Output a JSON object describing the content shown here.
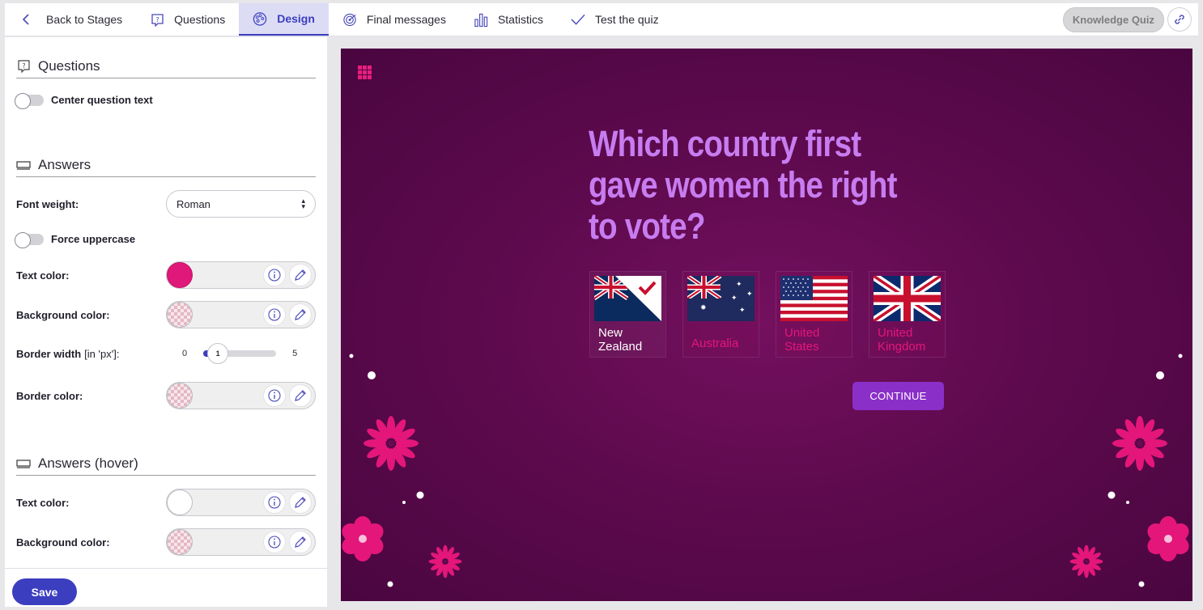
{
  "nav": {
    "back_label": "Back to Stages",
    "tabs": [
      {
        "label": "Questions",
        "icon": "question-bubble-icon"
      },
      {
        "label": "Design",
        "icon": "palette-icon"
      },
      {
        "label": "Final messages",
        "icon": "target-icon"
      },
      {
        "label": "Statistics",
        "icon": "bar-chart-icon"
      },
      {
        "label": "Test the quiz",
        "icon": "checkmark-icon"
      }
    ],
    "active_tab": "Design",
    "quiz_name": "Knowledge Quiz"
  },
  "panel": {
    "questions_section": {
      "title": "Questions",
      "center_text_label": "Center question text",
      "center_text_on": false
    },
    "answers_section": {
      "title": "Answers",
      "font_weight_label": "Font weight:",
      "font_weight_value": "Roman",
      "force_uppercase_label": "Force uppercase",
      "force_uppercase_on": false,
      "text_color_label": "Text color:",
      "text_color": "#e0187a",
      "bg_color_label": "Background color:",
      "border_width_label": "Border width",
      "border_width_unit": "[in 'px']:",
      "border_width_min": "0",
      "border_width_max": "5",
      "border_width_value": "1",
      "border_color_label": "Border color:"
    },
    "hover_section": {
      "title": "Answers (hover)",
      "text_color_label": "Text color:",
      "text_color": "#ffffff",
      "bg_color_label": "Background color:"
    },
    "save_label": "Save"
  },
  "preview": {
    "question": "Which country first gave women the right to vote?",
    "answers": [
      {
        "line1": "New",
        "line2": "Zealand",
        "selected": true
      },
      {
        "line1": "Australia",
        "line2": "",
        "selected": false
      },
      {
        "line1": "United",
        "line2": "States",
        "selected": false
      },
      {
        "line1": "United",
        "line2": "Kingdom",
        "selected": false
      }
    ],
    "continue_label": "CONTINUE",
    "colors": {
      "background": "#5e0a4e",
      "question": "#c77cf0",
      "accent": "#e4167a",
      "button": "#8b2fc9"
    }
  }
}
